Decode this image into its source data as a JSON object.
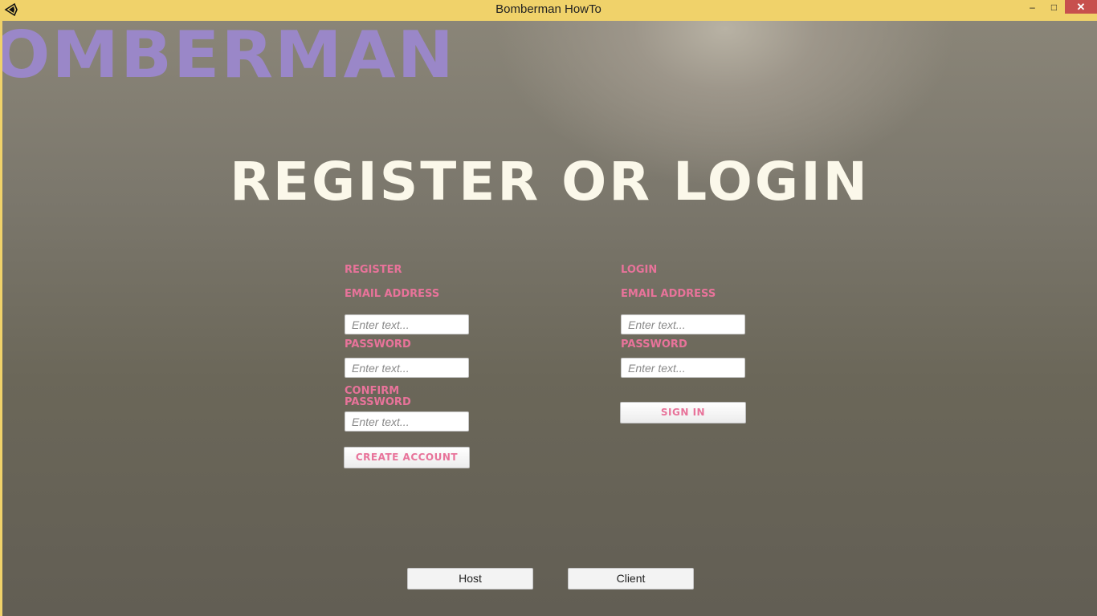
{
  "window": {
    "title": "Bomberman HowTo",
    "minimize_glyph": "–",
    "maximize_glyph": "□",
    "close_glyph": "✕"
  },
  "logo": {
    "text": "OMBERMAN"
  },
  "heading": "REGISTER OR LOGIN",
  "register": {
    "section_label": "REGISTER",
    "email_label": "EMAIL ADDRESS",
    "email_placeholder": "Enter text...",
    "password_label": "PASSWORD",
    "password_placeholder": "Enter text...",
    "confirm_label": "CONFIRM PASSWORD",
    "confirm_placeholder": "Enter text...",
    "submit_label": "CREATE ACCOUNT"
  },
  "login": {
    "section_label": "LOGIN",
    "email_label": "EMAIL ADDRESS",
    "email_placeholder": "Enter text...",
    "password_label": "PASSWORD",
    "password_placeholder": "Enter text...",
    "submit_label": "SIGN IN"
  },
  "network": {
    "host_label": "Host",
    "client_label": "Client"
  },
  "colors": {
    "titlebar": "#f0d26a",
    "logo": "#9a87c8",
    "heading": "#fbf8ea",
    "label_pink": "#e8739a",
    "close_button": "#c7504d"
  },
  "icons": {
    "app": "unity-logo-icon"
  }
}
